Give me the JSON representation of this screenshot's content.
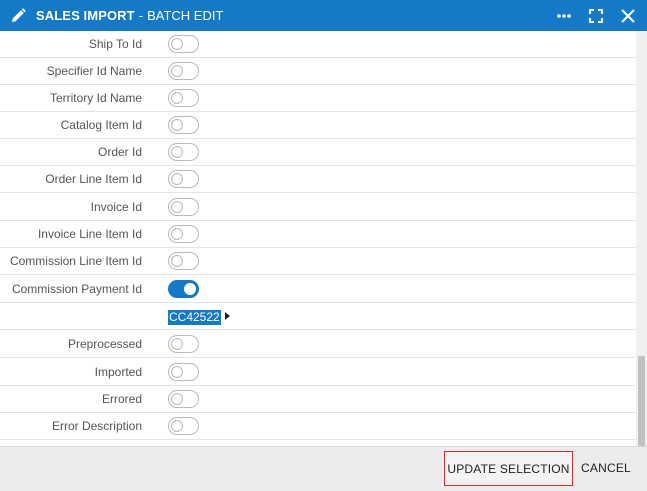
{
  "window": {
    "title": "SALES IMPORT",
    "separator": "-",
    "subtitle": "BATCH EDIT",
    "icons": {
      "title": "pencil-icon",
      "more": "more-icon",
      "maximize": "maximize-icon",
      "close": "close-icon"
    }
  },
  "fields": [
    {
      "label": "Ship To Id",
      "enabled": false
    },
    {
      "label": "Specifier Id Name",
      "enabled": false
    },
    {
      "label": "Territory Id Name",
      "enabled": false
    },
    {
      "label": "Catalog Item Id",
      "enabled": false
    },
    {
      "label": "Order Id",
      "enabled": false
    },
    {
      "label": "Order Line Item Id",
      "enabled": false
    },
    {
      "label": "Invoice Id",
      "enabled": false
    },
    {
      "label": "Invoice Line Item Id",
      "enabled": false
    },
    {
      "label": "Commission Line Item Id",
      "enabled": false
    },
    {
      "label": "Commission Payment Id",
      "enabled": true
    },
    {
      "label": "Preprocessed",
      "enabled": false
    },
    {
      "label": "Imported",
      "enabled": false
    },
    {
      "label": "Errored",
      "enabled": false
    },
    {
      "label": "Error Description",
      "enabled": false
    }
  ],
  "commission_payment_value": "CC42522",
  "footer": {
    "update_label": "UPDATE SELECTION",
    "cancel_label": "CANCEL"
  },
  "colors": {
    "accent": "#1479c7",
    "highlight_border": "#d0312d"
  }
}
